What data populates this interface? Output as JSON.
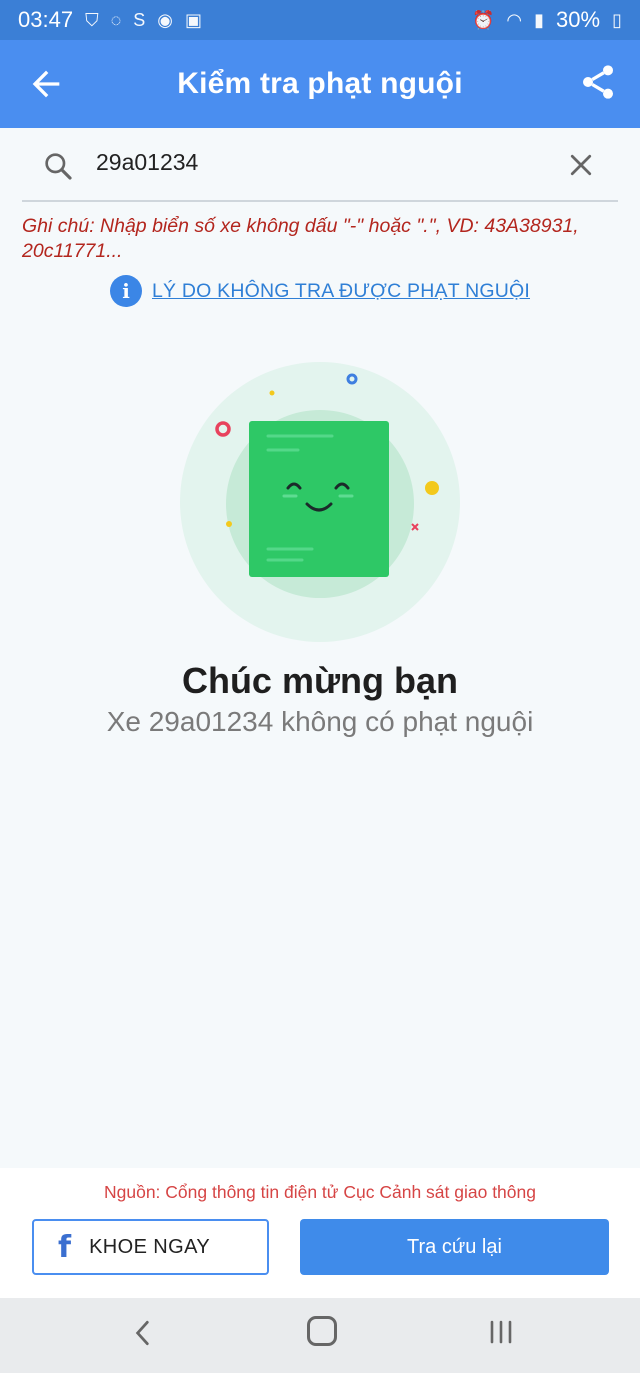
{
  "status_bar": {
    "time": "03:47",
    "battery": "30%"
  },
  "app_bar": {
    "title": "Kiểm tra phạt nguội",
    "back_icon": "arrow-left-icon",
    "share_icon": "share-icon"
  },
  "search": {
    "value": "29a01234",
    "search_icon": "search-icon",
    "clear_icon": "close-icon"
  },
  "note": "Ghi chú: Nhập biển số xe không dấu \"-\" hoặc \".\", VD: 43A38931, 20c11771...",
  "reason_link": "LÝ DO KHÔNG TRA ĐƯỢC PHẠT NGUỘI",
  "result": {
    "headline": "Chúc mừng bạn",
    "message": "Xe 29a01234 không có phạt nguội"
  },
  "footer": {
    "source": "Nguồn: Cổng thông tin điện tử Cục Cảnh sát giao thông",
    "share_button": "KHOE NGAY",
    "search_again_button": "Tra cứu lại"
  },
  "colors": {
    "primary": "#4a8ef0",
    "status_bar": "#3b7fd6",
    "note_red": "#b3261e",
    "source_red": "#d64545",
    "illustration_green": "#2ec866"
  }
}
